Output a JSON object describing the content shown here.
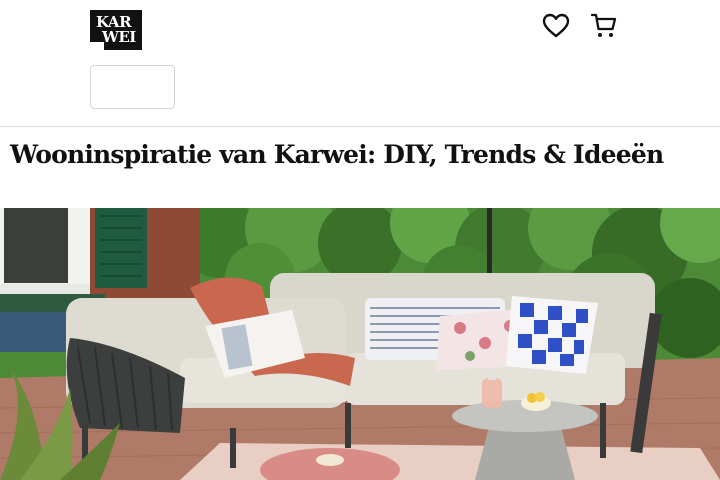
{
  "header": {
    "logo_line1": "KAR",
    "logo_line2": "WEI",
    "icons": [
      "heart-icon",
      "cart-icon"
    ]
  },
  "page": {
    "title": "Wooninspiratie van Karwei: DIY, Trends & Ideeën"
  },
  "hero": {
    "subject": "garden-lounge-set-photo"
  },
  "colors": {
    "logo_bg": "#111111",
    "foliage": "#3f7a2e",
    "cushion_blue": "#2f4fc7",
    "blanket_terracotta": "#c9674f"
  }
}
